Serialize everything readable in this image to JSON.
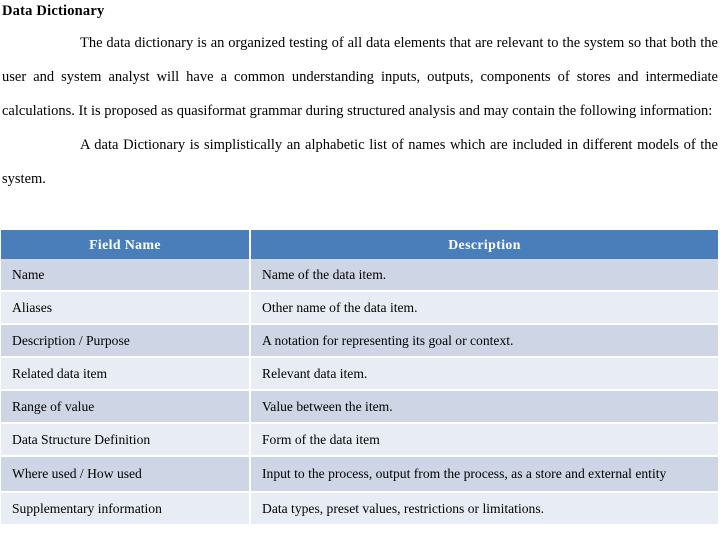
{
  "document": {
    "title": "Data Dictionary",
    "paragraphs": [
      {
        "id": "p1",
        "indent": true,
        "text": "The data dictionary is an organized testing of all data elements that are relevant to the system so that both the user and system analyst will have a common understanding inputs, outputs, components of stores and intermediate calculations. It is proposed as quasiformat grammar during structured analysis and may contain the following information:"
      },
      {
        "id": "p2",
        "indent": true,
        "text": "A data Dictionary is simplistically an alphabetic list of names which are included in different models of the system."
      }
    ]
  },
  "table": {
    "name": "data-dictionary-table",
    "header_bg": "#4a7ebb",
    "header_text_color": "#ffffff",
    "row_bg_dark": "#ced6e5",
    "row_bg_light": "#e8ecf4",
    "columns": [
      {
        "key": "field",
        "label": "Field Name"
      },
      {
        "key": "description",
        "label": "Description"
      }
    ],
    "rows": [
      {
        "field": "Name",
        "description": "Name of the data item."
      },
      {
        "field": "Aliases",
        "description": "Other name of the data item."
      },
      {
        "field": "Description / Purpose",
        "description": "A notation for representing its goal or context."
      },
      {
        "field": "Related data item",
        "description": "Relevant data item."
      },
      {
        "field": "Range of value",
        "description": "Value between the item."
      },
      {
        "field": "Data Structure Definition",
        "description": "Form of the data item"
      },
      {
        "field": "Where used / How used",
        "description": "Input to the process, output from the process, as a store and external entity"
      },
      {
        "field": "Supplementary information",
        "description": "Data types, preset values, restrictions or limitations."
      }
    ]
  }
}
